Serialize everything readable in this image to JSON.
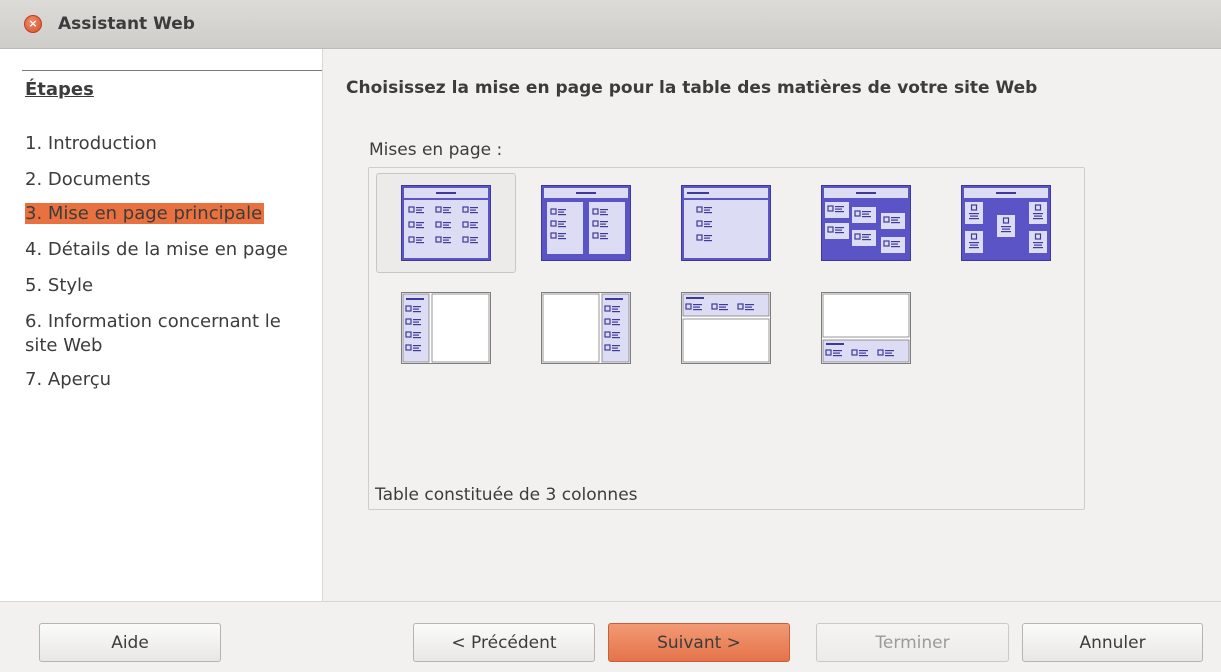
{
  "window": {
    "title": "Assistant Web",
    "close_glyph": "×"
  },
  "sidebar": {
    "title": "Étapes",
    "items": [
      {
        "label": "1. Introduction"
      },
      {
        "label": "2. Documents"
      },
      {
        "label": "3. Mise en page principale",
        "active": true
      },
      {
        "label": "4. Détails de la mise en page"
      },
      {
        "label": "5. Style"
      },
      {
        "label": "6. Information concernant le site Web"
      },
      {
        "label": "7. Aperçu"
      }
    ]
  },
  "main": {
    "heading": "Choisissez la mise en page pour la table des matières de votre site Web",
    "layouts_label": "Mises en page :",
    "selected_description": "Table constituée de 3 colonnes",
    "layouts": [
      {
        "icon": "layout-3-columns-icon",
        "selected": true
      },
      {
        "icon": "layout-2-columns-icon"
      },
      {
        "icon": "layout-1-column-icon"
      },
      {
        "icon": "layout-staggered-icon"
      },
      {
        "icon": "layout-centered-icon"
      },
      {
        "icon": "layout-frame-left-icon"
      },
      {
        "icon": "layout-frame-right-icon"
      },
      {
        "icon": "layout-frame-top-icon"
      },
      {
        "icon": "layout-frame-bottom-icon"
      }
    ]
  },
  "buttons": {
    "help": "Aide",
    "previous": "< Précédent",
    "next": "Suivant >",
    "finish": "Terminer",
    "cancel": "Annuler"
  },
  "colors": {
    "accent": "#e9703f",
    "layout_purple": "#5b54c7",
    "layout_light": "#dcdcf5"
  }
}
